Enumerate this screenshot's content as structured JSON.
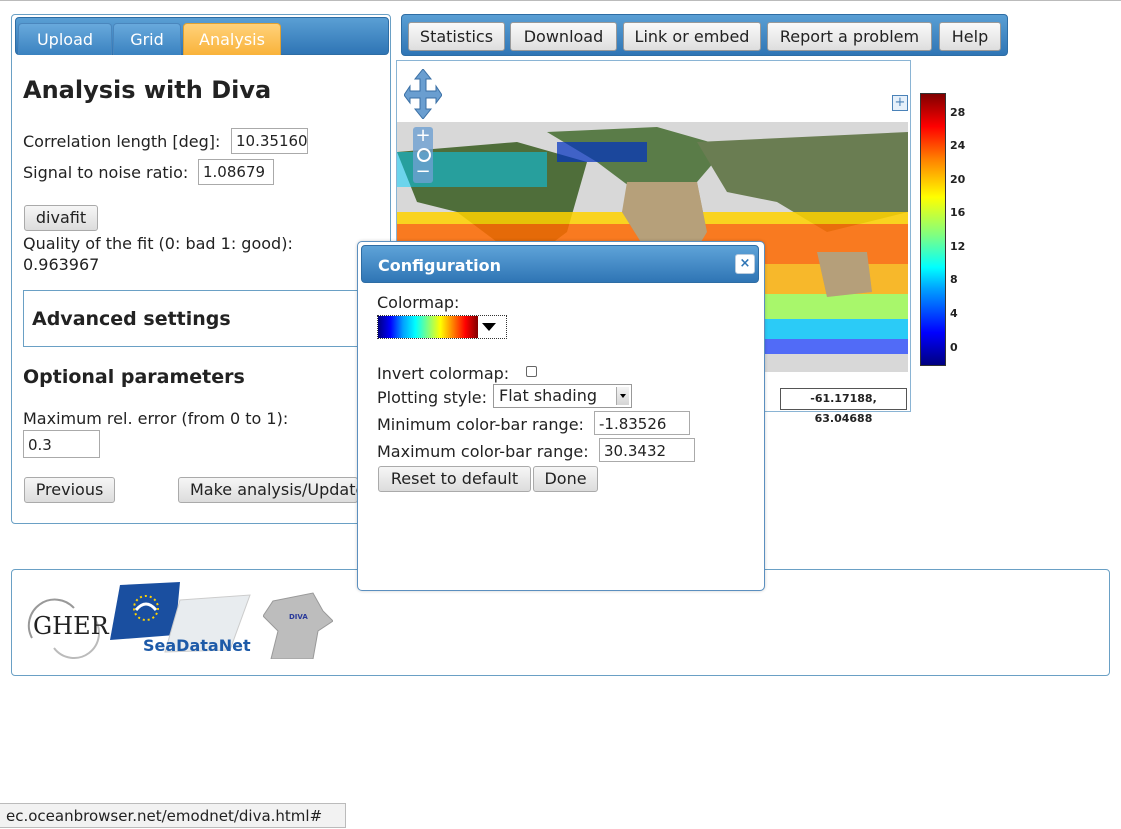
{
  "tabs": [
    {
      "label": "Upload"
    },
    {
      "label": "Grid"
    },
    {
      "label": "Analysis"
    }
  ],
  "analysis": {
    "title": "Analysis with Diva",
    "corr_label": "Correlation length [deg]:",
    "corr_value": "10.35160",
    "snr_label": "Signal to noise ratio:",
    "snr_value": "1.08679",
    "divafit_button": "divafit",
    "quality_label": "Quality of the fit (0: bad 1: good):",
    "quality_value": "0.963967",
    "advanced_heading": "Advanced settings",
    "optional_heading": "Optional parameters",
    "max_err_label": "Maximum rel. error (from 0 to 1):",
    "max_err_value": "0.3",
    "previous_button": "Previous",
    "make_button": "Make analysis/Update"
  },
  "toolbar": {
    "statistics": "Statistics",
    "download": "Download",
    "link": "Link or embed",
    "report": "Report a problem",
    "help": "Help"
  },
  "map": {
    "coordinates": "-61.17188, 63.04688"
  },
  "colorbar": {
    "ticks": [
      "28",
      "24",
      "20",
      "16",
      "12",
      "8",
      "4",
      "0"
    ],
    "colors": [
      "#000080",
      "#0000ff",
      "#00ffff",
      "#ffff00",
      "#ff0000",
      "#800000"
    ]
  },
  "dialog": {
    "title": "Configuration",
    "close": "×",
    "colormap_label": "Colormap:",
    "invert_label": "Invert colormap:",
    "plotting_label": "Plotting style:",
    "plotting_value": "Flat shading",
    "min_label": "Minimum color-bar range:",
    "min_value": "-1.83526",
    "max_label": "Maximum color-bar range:",
    "max_value": "30.3432",
    "reset_button": "Reset to default",
    "done_button": "Done"
  },
  "logos": {
    "gher": "GHER",
    "seadatanet": "SeaDataNet",
    "diva": "DIVA"
  },
  "status_bar": "ec.oceanbrowser.net/emodnet/diva.html#"
}
